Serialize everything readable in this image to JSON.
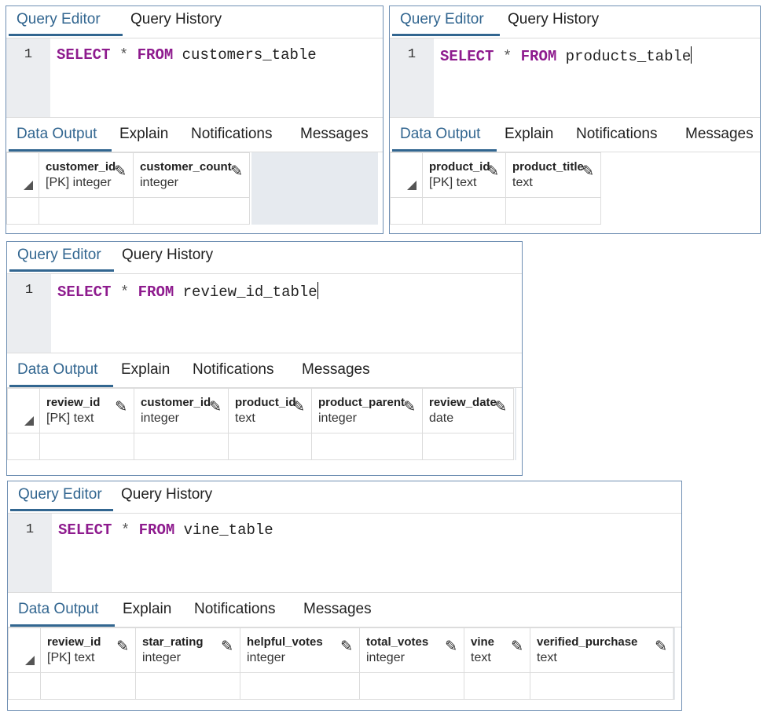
{
  "panels": [
    {
      "tabs": [
        "Query Editor",
        "Query History"
      ],
      "line_number": "1",
      "code": {
        "kw1": "SELECT",
        "star": "*",
        "kw2": "FROM",
        "table": "customers_table"
      },
      "result_tabs": [
        "Data Output",
        "Explain",
        "Notifications",
        "Messages"
      ],
      "columns": [
        {
          "name": "customer_id",
          "type": "[PK] integer"
        },
        {
          "name": "customer_count",
          "type": "integer"
        }
      ]
    },
    {
      "tabs": [
        "Query Editor",
        "Query History"
      ],
      "line_number": "1",
      "code": {
        "kw1": "SELECT",
        "star": "*",
        "kw2": "FROM",
        "table": "products_table"
      },
      "result_tabs": [
        "Data Output",
        "Explain",
        "Notifications",
        "Messages"
      ],
      "columns": [
        {
          "name": "product_id",
          "type": "[PK] text"
        },
        {
          "name": "product_title",
          "type": "text"
        }
      ]
    },
    {
      "tabs": [
        "Query Editor",
        "Query History"
      ],
      "line_number": "1",
      "code": {
        "kw1": "SELECT",
        "star": "*",
        "kw2": "FROM",
        "table": "review_id_table"
      },
      "result_tabs": [
        "Data Output",
        "Explain",
        "Notifications",
        "Messages"
      ],
      "columns": [
        {
          "name": "review_id",
          "type": "[PK] text"
        },
        {
          "name": "customer_id",
          "type": "integer"
        },
        {
          "name": "product_id",
          "type": "text"
        },
        {
          "name": "product_parent",
          "type": "integer"
        },
        {
          "name": "review_date",
          "type": "date"
        }
      ]
    },
    {
      "tabs": [
        "Query Editor",
        "Query History"
      ],
      "line_number": "1",
      "code": {
        "kw1": "SELECT",
        "star": "*",
        "kw2": "FROM",
        "table": "vine_table"
      },
      "result_tabs": [
        "Data Output",
        "Explain",
        "Notifications",
        "Messages"
      ],
      "columns": [
        {
          "name": "review_id",
          "type": "[PK] text"
        },
        {
          "name": "star_rating",
          "type": "integer"
        },
        {
          "name": "helpful_votes",
          "type": "integer"
        },
        {
          "name": "total_votes",
          "type": "integer"
        },
        {
          "name": "vine",
          "type": "text"
        },
        {
          "name": "verified_purchase",
          "type": "text"
        }
      ]
    }
  ],
  "icons": {
    "edit_column": "pencil-icon",
    "sort_corner": "corner-triangle-icon"
  },
  "colors": {
    "accent": "#326690",
    "keyword": "#8e1b8e",
    "panel_border": "#6f8fb3",
    "gutter": "#ebedf0"
  }
}
